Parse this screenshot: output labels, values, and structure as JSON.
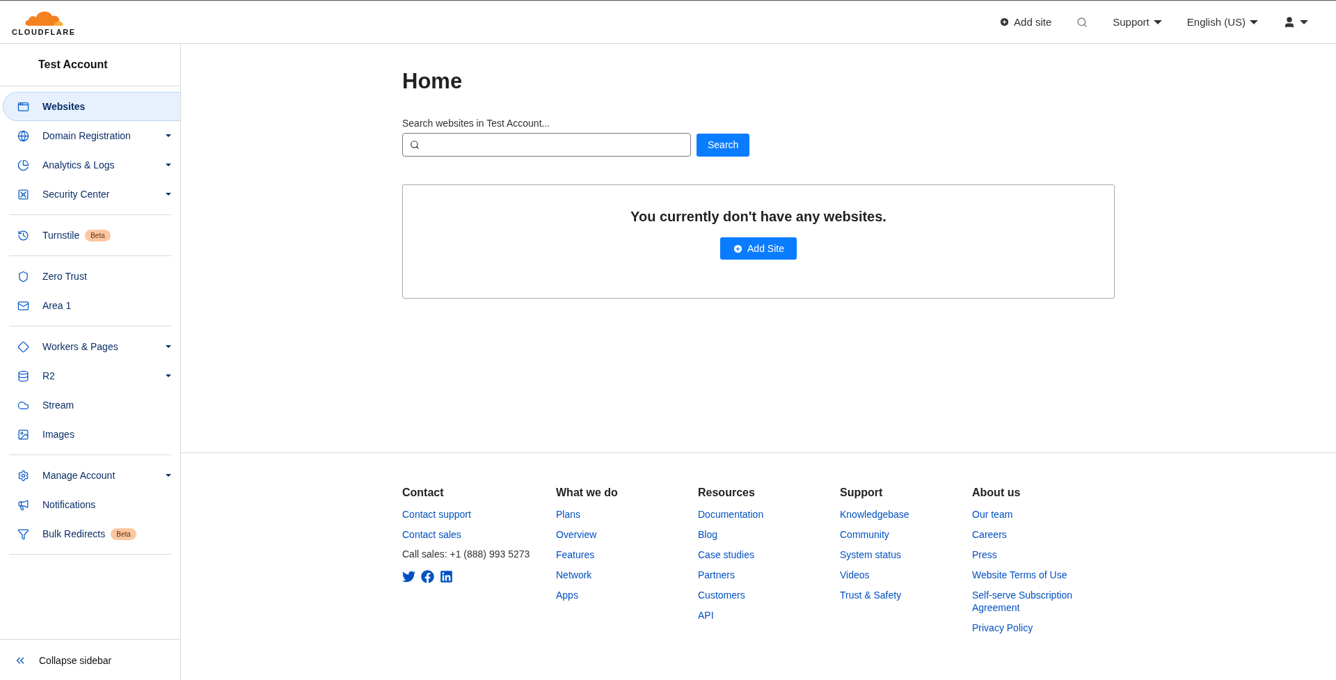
{
  "brand": {
    "name": "CLOUDFLARE"
  },
  "header": {
    "add_site": "Add site",
    "menus": [
      {
        "label": "Support"
      },
      {
        "label": "English (US)"
      }
    ]
  },
  "sidebar": {
    "account": "Test Account",
    "groups": [
      [
        {
          "label": "Websites",
          "selected": true,
          "expandable": false
        },
        {
          "label": "Domain Registration",
          "selected": false,
          "expandable": true
        },
        {
          "label": "Analytics & Logs",
          "selected": false,
          "expandable": true
        },
        {
          "label": "Security Center",
          "selected": false,
          "expandable": true
        }
      ],
      [
        {
          "label": "Turnstile",
          "selected": false,
          "expandable": false,
          "badge": "Beta"
        }
      ],
      [
        {
          "label": "Zero Trust",
          "selected": false,
          "expandable": false
        },
        {
          "label": "Area 1",
          "selected": false,
          "expandable": false
        }
      ],
      [
        {
          "label": "Workers & Pages",
          "selected": false,
          "expandable": true
        },
        {
          "label": "R2",
          "selected": false,
          "expandable": true
        },
        {
          "label": "Stream",
          "selected": false,
          "expandable": false
        },
        {
          "label": "Images",
          "selected": false,
          "expandable": false
        }
      ],
      [
        {
          "label": "Manage Account",
          "selected": false,
          "expandable": true
        },
        {
          "label": "Notifications",
          "selected": false,
          "expandable": false
        },
        {
          "label": "Bulk Redirects",
          "selected": false,
          "expandable": false,
          "badge": "Beta"
        }
      ]
    ],
    "collapse": "Collapse sidebar"
  },
  "main": {
    "title": "Home",
    "search_label": "Search websites in Test Account...",
    "search_button": "Search",
    "empty_message": "You currently don't have any websites.",
    "add_button": "Add Site"
  },
  "footer": {
    "columns": [
      {
        "heading": "Contact",
        "links": [
          "Contact support",
          "Contact sales"
        ],
        "note": "Call sales: +1 (888) 993 5273",
        "social": true
      },
      {
        "heading": "What we do",
        "links": [
          "Plans",
          "Overview",
          "Features",
          "Network",
          "Apps"
        ]
      },
      {
        "heading": "Resources",
        "links": [
          "Documentation",
          "Blog",
          "Case studies",
          "Partners",
          "Customers",
          "API"
        ]
      },
      {
        "heading": "Support",
        "links": [
          "Knowledgebase",
          "Community",
          "System status",
          "Videos",
          "Trust & Safety"
        ]
      },
      {
        "heading": "About us",
        "links": [
          "Our team",
          "Careers",
          "Press",
          "Website Terms of Use",
          "Self-serve Subscription Agreement",
          "Privacy Policy"
        ]
      }
    ]
  }
}
